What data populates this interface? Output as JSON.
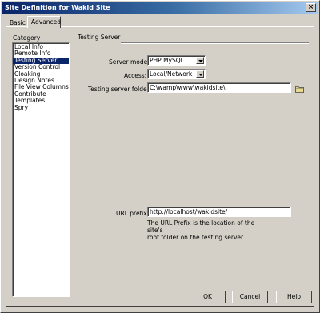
{
  "window": {
    "title": "Site Definition for Wakid Site",
    "close_label": "×"
  },
  "tabs": [
    {
      "label": "Basic"
    },
    {
      "label": "Advanced"
    }
  ],
  "category": {
    "header": "Category",
    "items": [
      "Local Info",
      "Remote Info",
      "Testing Server",
      "Version Control",
      "Cloaking",
      "Design Notes",
      "File View Columns",
      "Contribute",
      "Templates",
      "Spry"
    ],
    "selected": "Testing Server"
  },
  "testing_server": {
    "section_title": "Testing Server",
    "server_model_label": "Server model:",
    "server_model_value": "PHP MySQL",
    "access_label": "Access:",
    "access_value": "Local/Network",
    "folder_label": "Testing server folder:",
    "folder_value": "C:\\wamp\\www\\wakidsite\\",
    "url_prefix_label": "URL prefix:",
    "url_prefix_value": "http://localhost/wakidsite/",
    "url_prefix_help_line1": "The URL Prefix is the location of the site's",
    "url_prefix_help_line2": "root folder on the testing server."
  },
  "buttons": {
    "ok": "OK",
    "cancel": "Cancel",
    "help": "Help"
  },
  "icons": {
    "folder": "folder-icon",
    "dropdown": "chevron-down-icon",
    "close": "close-icon"
  }
}
